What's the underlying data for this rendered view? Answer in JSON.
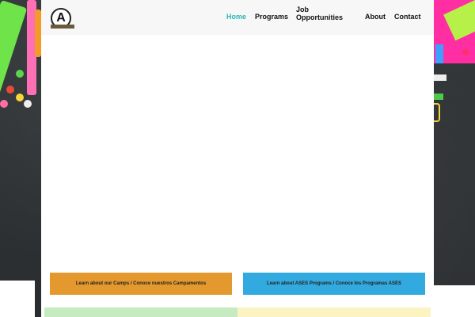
{
  "logo": {
    "letter": "A"
  },
  "nav": {
    "items": [
      {
        "label": "Home",
        "active": true
      },
      {
        "label": "Programs",
        "active": false
      },
      {
        "label": "Job Opportunities",
        "active": false
      },
      {
        "label": "About",
        "active": false
      },
      {
        "label": "Contact",
        "active": false
      }
    ],
    "active_color": "#2bb5b8"
  },
  "cta": {
    "camps_label": "Learn about our Camps / Conoce nuestros Campamentos",
    "camps_color": "#e4992e",
    "ases_label": "Learn about ASES Programs / Conoce los Programas ASES",
    "ases_color": "#33aadf"
  },
  "icons": [
    "school-logo-icon"
  ]
}
